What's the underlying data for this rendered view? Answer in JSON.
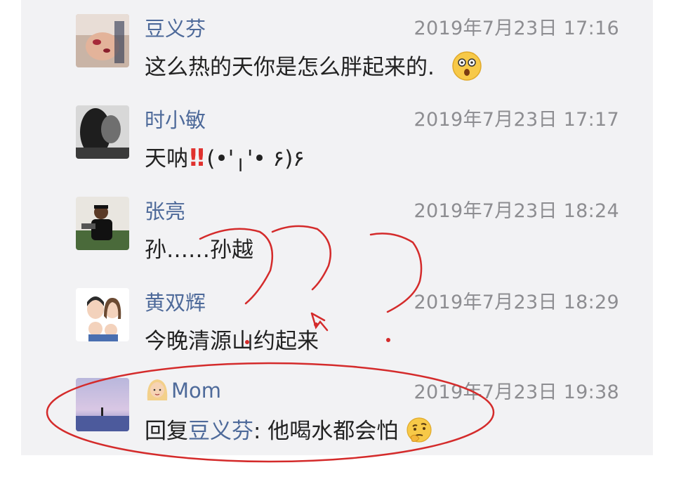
{
  "comments": [
    {
      "name": "豆义芬",
      "time": "2019年7月23日 17:16",
      "text": "这么热的天你是怎么胖起来的.",
      "emoji": "dizzy-face-emoji"
    },
    {
      "name": "时小敏",
      "time": "2019年7月23日 17:17",
      "text_before": "天呐",
      "exclaim": "‼",
      "text_after": "(•'╷'• ۶)۶"
    },
    {
      "name": "张亮",
      "time": "2019年7月23日 18:24",
      "text": "孙……孙越"
    },
    {
      "name": "黄双辉",
      "time": "2019年7月23日 18:29",
      "text": "今晚清源山约起来"
    },
    {
      "name": "Mom",
      "name_emoji": "blonde-woman-emoji",
      "time": "2019年7月23日 19:38",
      "reply_prefix": "回复",
      "reply_to": "豆义芬",
      "text": ": 他喝水都会怕",
      "emoji": "thinking-face-emoji"
    }
  ],
  "annotations": {
    "ink_color": "#d42b2b"
  }
}
